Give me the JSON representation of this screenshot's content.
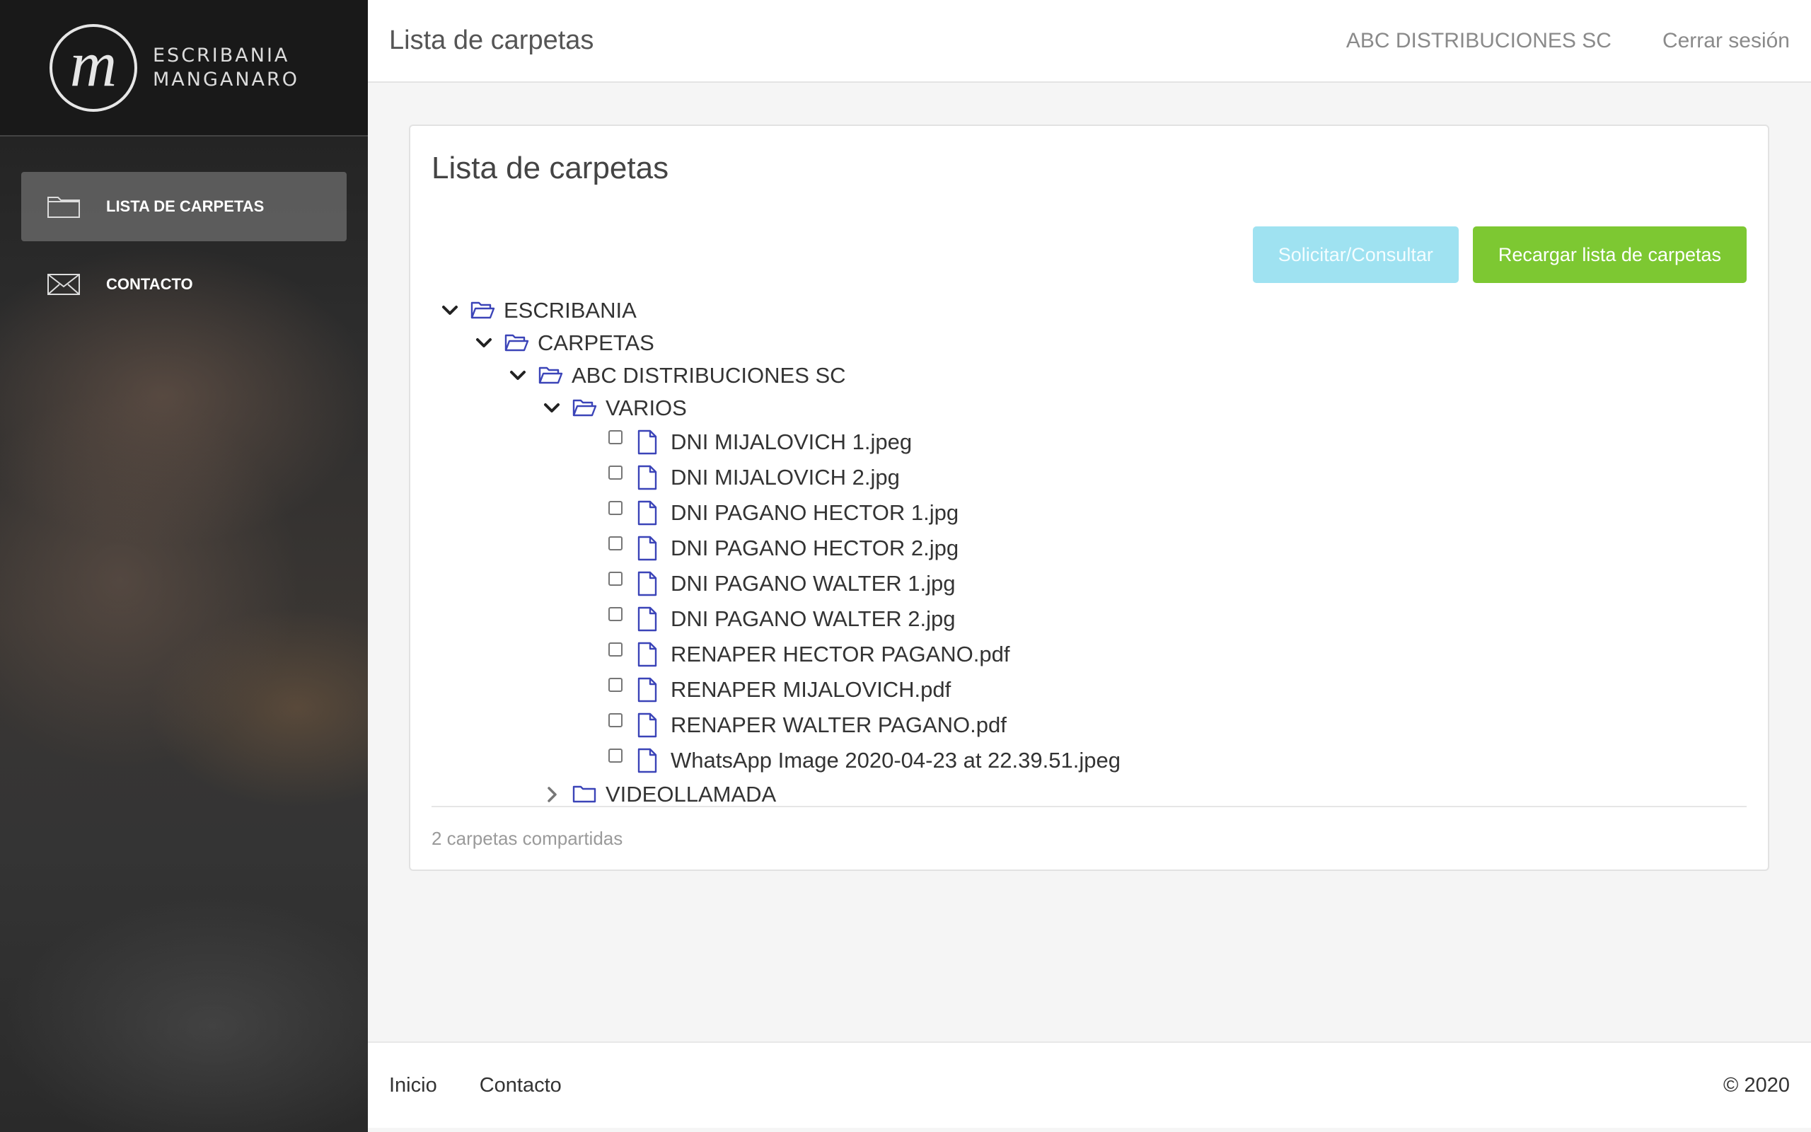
{
  "brand": {
    "logo_letter": "m",
    "name_line1": "ESCRIBANIA",
    "name_line2": "MANGANARO"
  },
  "sidebar": {
    "items": [
      {
        "label": "LISTA DE CARPETAS",
        "icon": "folder-icon",
        "active": true
      },
      {
        "label": "CONTACTO",
        "icon": "envelope-icon",
        "active": false
      }
    ]
  },
  "header": {
    "title": "Lista de carpetas",
    "user": "ABC DISTRIBUCIONES SC",
    "logout": "Cerrar sesión"
  },
  "card": {
    "title": "Lista de carpetas",
    "btn_request": "Solicitar/Consultar",
    "btn_reload": "Recargar lista de carpetas",
    "footer_text": "2 carpetas compartidas"
  },
  "tree": {
    "root": "ESCRIBANIA",
    "carpetas": "CARPETAS",
    "client": "ABC DISTRIBUCIONES SC",
    "varios": "VARIOS",
    "files": [
      "DNI MIJALOVICH 1.jpeg",
      "DNI MIJALOVICH 2.jpg",
      "DNI PAGANO HECTOR 1.jpg",
      "DNI PAGANO HECTOR 2.jpg",
      "DNI PAGANO WALTER 1.jpg",
      "DNI PAGANO WALTER 2.jpg",
      "RENAPER HECTOR PAGANO.pdf",
      "RENAPER MIJALOVICH.pdf",
      "RENAPER WALTER PAGANO.pdf",
      "WhatsApp Image 2020-04-23 at 22.39.51.jpeg"
    ],
    "videollamada": "VIDEOLLAMADA"
  },
  "footer": {
    "home": "Inicio",
    "contact": "Contacto",
    "copyright": "© 2020"
  },
  "colors": {
    "sidebar_active": "#6e6e6e",
    "btn_info": "#9fe2f1",
    "btn_success": "#7dc832",
    "tree_icon": "#3b44b8"
  }
}
